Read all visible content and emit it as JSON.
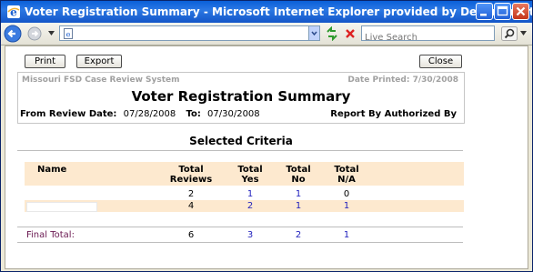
{
  "window": {
    "title": "Voter Registration Summary - Microsoft Internet Explorer provided by Department of Social Services"
  },
  "browser": {
    "url": "",
    "search_placeholder": "Live Search"
  },
  "toolbar": {
    "print_label": "Print",
    "export_label": "Export",
    "close_label": "Close"
  },
  "report": {
    "system_name": "Missouri FSD Case Review System",
    "date_printed": "Date Printed: 7/30/2008",
    "title": "Voter Registration Summary",
    "from_label": "From Review Date:",
    "from_value": "07/28/2008",
    "to_label": "To:",
    "to_value": "07/30/2008",
    "report_by": "Report By Authorized By",
    "selected_criteria": "Selected Criteria"
  },
  "table": {
    "headers": {
      "name": "Name",
      "total_reviews": [
        "Total",
        "Reviews"
      ],
      "total_yes": [
        "Total",
        "Yes"
      ],
      "total_no": [
        "Total",
        "No"
      ],
      "total_na": [
        "Total",
        "N/A"
      ]
    },
    "rows": [
      {
        "name": "",
        "reviews": "2",
        "yes": "1",
        "no": "1",
        "na": "0"
      },
      {
        "name": "",
        "reviews": "4",
        "yes": "2",
        "no": "1",
        "na": "1"
      }
    ],
    "final": {
      "label": "Final Total:",
      "reviews": "6",
      "yes": "3",
      "no": "2",
      "na": "1"
    }
  }
}
